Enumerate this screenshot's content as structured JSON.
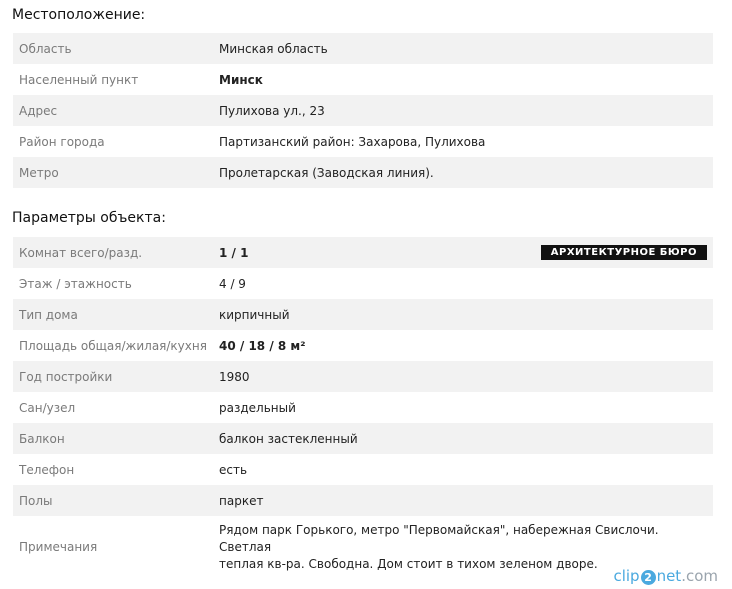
{
  "location": {
    "title": "Местоположение:",
    "rows": [
      {
        "label": "Область",
        "value": "Минская область"
      },
      {
        "label": "Населенный пункт",
        "value": "Минск"
      },
      {
        "label": "Адрес",
        "value": "Пулихова ул., 23"
      },
      {
        "label": "Район города",
        "value": "Партизанский район: Захарова, Пулихова"
      },
      {
        "label": "Метро",
        "value": "Пролетарская (Заводская линия)."
      }
    ]
  },
  "params": {
    "title": "Параметры объекта:",
    "badge": "АРХИТЕКТУРНОЕ БЮРО",
    "rows": [
      {
        "label": "Комнат всего/разд.",
        "value": "1 / 1"
      },
      {
        "label": "Этаж / этажность",
        "value": "4 / 9"
      },
      {
        "label": "Тип дома",
        "value": "кирпичный"
      },
      {
        "label": "Площадь общая/жилая/кухня",
        "value": "40 / 18 / 8 м²"
      },
      {
        "label": "Год постройки",
        "value": "1980"
      },
      {
        "label": "Сан/узел",
        "value": "раздельный"
      },
      {
        "label": "Балкон",
        "value": "балкон застекленный"
      },
      {
        "label": "Телефон",
        "value": "есть"
      },
      {
        "label": "Полы",
        "value": "паркет"
      },
      {
        "label": "Примечания",
        "value_line1": "Рядом парк Горького, метро \"Первомайская\", набережная Свислочи. Светлая",
        "value_line2": "теплая кв-ра. Свободна. Дом стоит в тихом зеленом дворе."
      }
    ]
  },
  "watermark": {
    "clip": "clip",
    "two": "2",
    "net": "net",
    "com": ".com"
  }
}
